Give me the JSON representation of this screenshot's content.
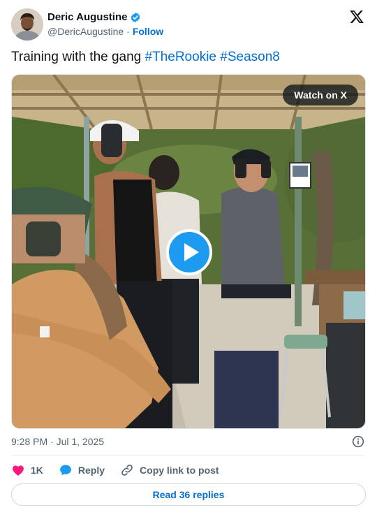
{
  "author": {
    "name": "Deric Augustine",
    "handle": "@DericAugustine",
    "separator": "·",
    "follow_label": "Follow",
    "avatar_icon": "profile-photo",
    "verified_icon": "verified-badge-icon"
  },
  "brand": {
    "logo": "x-logo-icon"
  },
  "tweet": {
    "text": "Training with the gang",
    "hashtags": [
      "#TheRookie",
      "#Season8"
    ]
  },
  "media": {
    "watch_label": "Watch on X",
    "play_icon": "play-icon"
  },
  "meta": {
    "timestamp": "9:28 PM · Jul 1, 2025",
    "info_icon": "info-icon"
  },
  "actions": {
    "like_count": "1K",
    "reply_label": "Reply",
    "copy_label": "Copy link to post"
  },
  "footer": {
    "read_replies_label": "Read 36 replies"
  },
  "colors": {
    "link": "#006fd6",
    "like": "#f91880",
    "reply_icon": "#1d9bf0",
    "play": "#1d9bf0",
    "text": "#0f1419",
    "muted": "#536471"
  }
}
